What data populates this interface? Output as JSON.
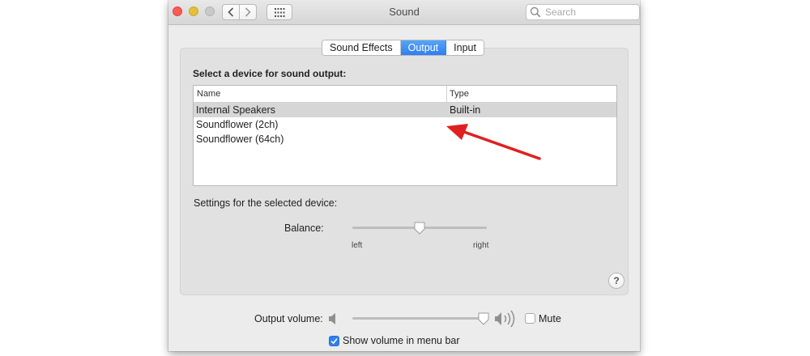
{
  "window": {
    "title": "Sound",
    "search": {
      "placeholder": "Search"
    }
  },
  "tabs": [
    {
      "label": "Sound Effects",
      "selected": false
    },
    {
      "label": "Output",
      "selected": true
    },
    {
      "label": "Input",
      "selected": false
    }
  ],
  "output": {
    "heading": "Select a device for sound output:",
    "columns": {
      "name": "Name",
      "type": "Type"
    },
    "devices": [
      {
        "name": "Internal Speakers",
        "type": "Built-in",
        "selected": true
      },
      {
        "name": "Soundflower (2ch)",
        "type": "",
        "selected": false
      },
      {
        "name": "Soundflower (64ch)",
        "type": "",
        "selected": false
      }
    ],
    "settings_label": "Settings for the selected device:",
    "balance": {
      "label": "Balance:",
      "left_label": "left",
      "right_label": "right",
      "value": 0.5
    }
  },
  "help_label": "?",
  "volume": {
    "label": "Output volume:",
    "value": 1.0,
    "mute_label": "Mute",
    "mute_checked": false
  },
  "menu_bar": {
    "label": "Show volume in menu bar",
    "checked": true
  },
  "colors": {
    "accent": "#2f7ff0",
    "annotation_arrow": "#e02020"
  },
  "icons": [
    "back-icon",
    "forward-icon",
    "grid-icon",
    "search-icon",
    "speaker-low-icon",
    "speaker-high-icon",
    "checkmark-icon"
  ]
}
